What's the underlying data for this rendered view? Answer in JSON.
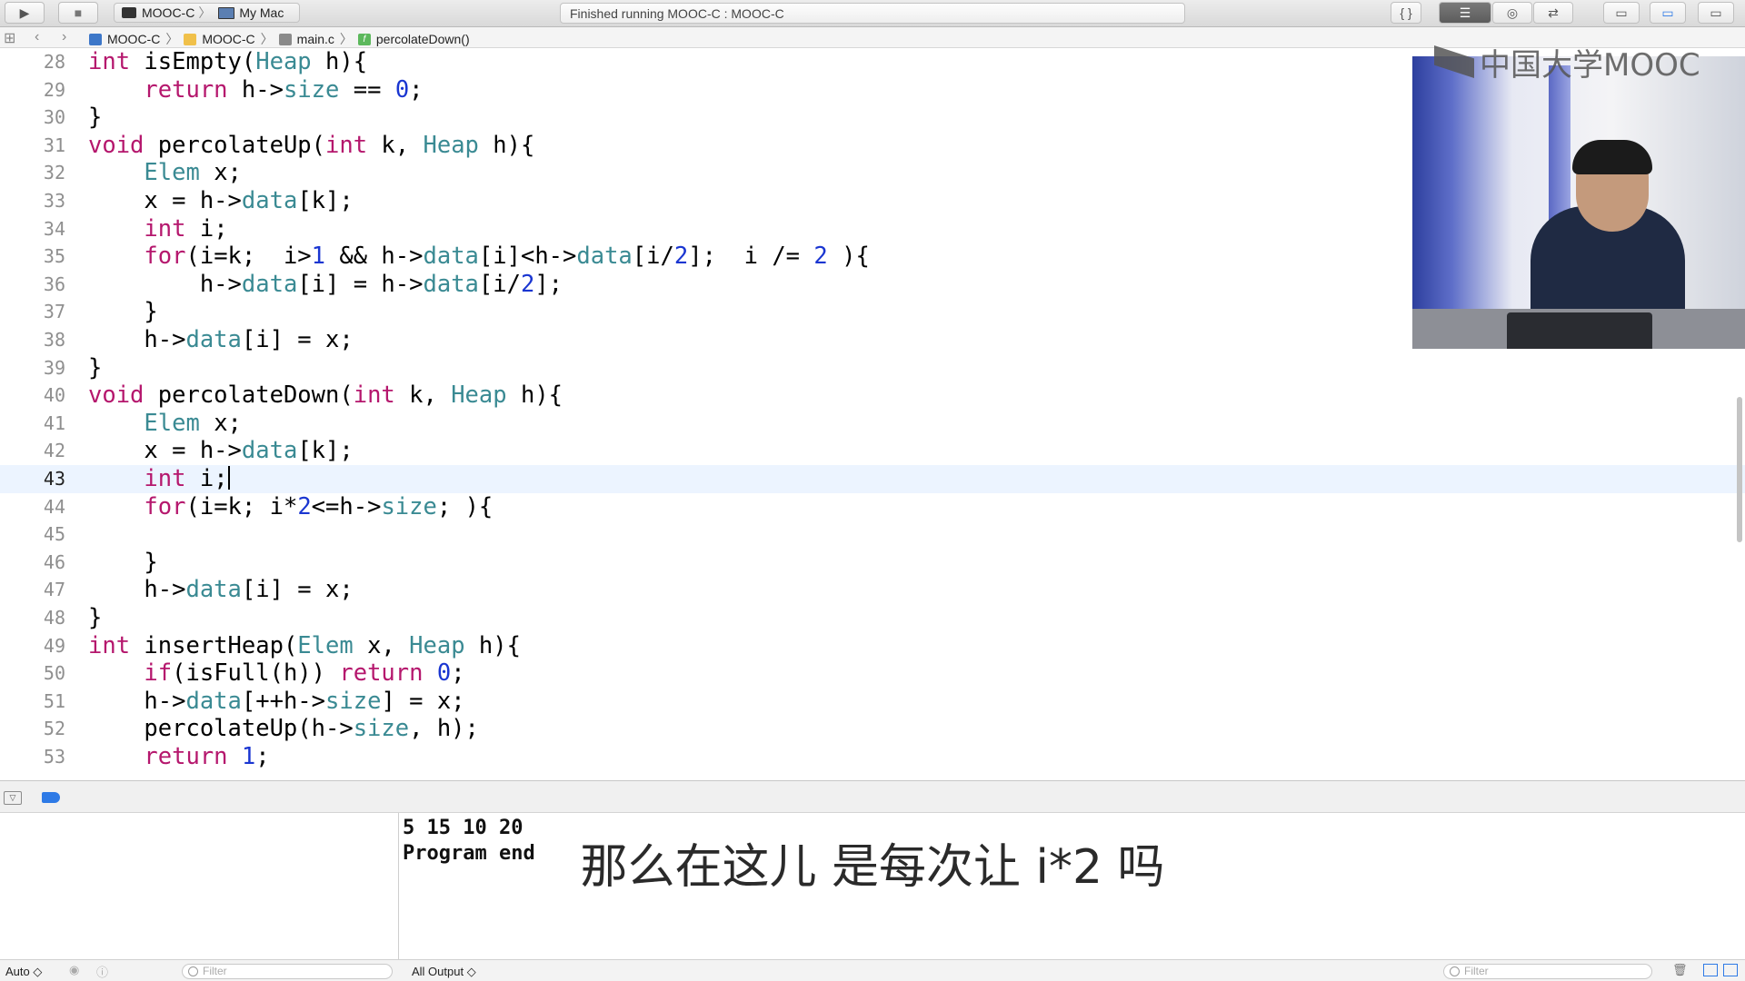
{
  "toolbar": {
    "scheme": "MOOC-C",
    "destination": "My Mac",
    "activity_status": "Finished running MOOC-C : MOOC-C",
    "run_glyph": "▶",
    "stop_glyph": "■"
  },
  "jumpbar": {
    "crumbs": [
      "MOOC-C",
      "MOOC-C",
      "main.c",
      "percolateDown()"
    ]
  },
  "editor": {
    "current_line": 43,
    "lines": [
      {
        "n": 28,
        "html": "<span class=\"kw\">int</span> isEmpty(<span class=\"ty\">Heap</span> h){"
      },
      {
        "n": 29,
        "html": "    <span class=\"kw\">return</span> h-&gt;<span class=\"mb\">size</span> == <span class=\"nu\">0</span>;"
      },
      {
        "n": 30,
        "html": "}"
      },
      {
        "n": 31,
        "html": "<span class=\"kw\">void</span> percolateUp(<span class=\"kw\">int</span> k, <span class=\"ty\">Heap</span> h){"
      },
      {
        "n": 32,
        "html": "    <span class=\"ty\">Elem</span> x;"
      },
      {
        "n": 33,
        "html": "    x = h-&gt;<span class=\"mb\">data</span>[k];"
      },
      {
        "n": 34,
        "html": "    <span class=\"kw\">int</span> i;"
      },
      {
        "n": 35,
        "html": "    <span class=\"kw\">for</span>(i=k;  i&gt;<span class=\"nu\">1</span> &amp;&amp; h-&gt;<span class=\"mb\">data</span>[i]&lt;h-&gt;<span class=\"mb\">data</span>[i/<span class=\"nu\">2</span>];  i /= <span class=\"nu\">2</span> ){"
      },
      {
        "n": 36,
        "html": "        h-&gt;<span class=\"mb\">data</span>[i] = h-&gt;<span class=\"mb\">data</span>[i/<span class=\"nu\">2</span>];"
      },
      {
        "n": 37,
        "html": "    }"
      },
      {
        "n": 38,
        "html": "    h-&gt;<span class=\"mb\">data</span>[i] = x;"
      },
      {
        "n": 39,
        "html": "}"
      },
      {
        "n": 40,
        "html": "<span class=\"kw\">void</span> percolateDown(<span class=\"kw\">int</span> k, <span class=\"ty\">Heap</span> h){"
      },
      {
        "n": 41,
        "html": "    <span class=\"ty\">Elem</span> x;"
      },
      {
        "n": 42,
        "html": "    x = h-&gt;<span class=\"mb\">data</span>[k];"
      },
      {
        "n": 43,
        "html": "    <span class=\"kw\">int</span> i;<span class=\"caret\" data-name=\"text-caret\" data-interactable=\"false\"></span>"
      },
      {
        "n": 44,
        "html": "    <span class=\"kw\">for</span>(i=k; i*<span class=\"nu\">2</span>&lt;=h-&gt;<span class=\"mb\">size</span>; ){"
      },
      {
        "n": 45,
        "html": ""
      },
      {
        "n": 46,
        "html": "    }"
      },
      {
        "n": 47,
        "html": "    h-&gt;<span class=\"mb\">data</span>[i] = x;"
      },
      {
        "n": 48,
        "html": "}"
      },
      {
        "n": 49,
        "html": "<span class=\"kw\">int</span> insertHeap(<span class=\"ty\">Elem</span> x, <span class=\"ty\">Heap</span> h){"
      },
      {
        "n": 50,
        "html": "    <span class=\"kw\">if</span>(isFull(h)) <span class=\"kw\">return</span> <span class=\"nu\">0</span>;"
      },
      {
        "n": 51,
        "html": "    h-&gt;<span class=\"mb\">data</span>[++h-&gt;<span class=\"mb\">size</span>] = x;"
      },
      {
        "n": 52,
        "html": "    percolateUp(h-&gt;<span class=\"mb\">size</span>, h);"
      },
      {
        "n": 53,
        "html": "    <span class=\"kw\">return</span> <span class=\"nu\">1</span>;"
      }
    ]
  },
  "video": {
    "logo_text": "中国大学MOOC"
  },
  "console": {
    "output_line_1": "5 15 10 20",
    "output_line_2": "Program end",
    "subtitle": "那么在这儿 是每次让 i*2 吗"
  },
  "bottombar": {
    "auto_label": "Auto ◇",
    "filter_placeholder": "Filter",
    "output_selector": "All Output ◇"
  },
  "colors": {
    "keyword": "#b5176d",
    "type": "#3a8a93",
    "number": "#1a36d1",
    "current_line": "#ecf4ff"
  }
}
